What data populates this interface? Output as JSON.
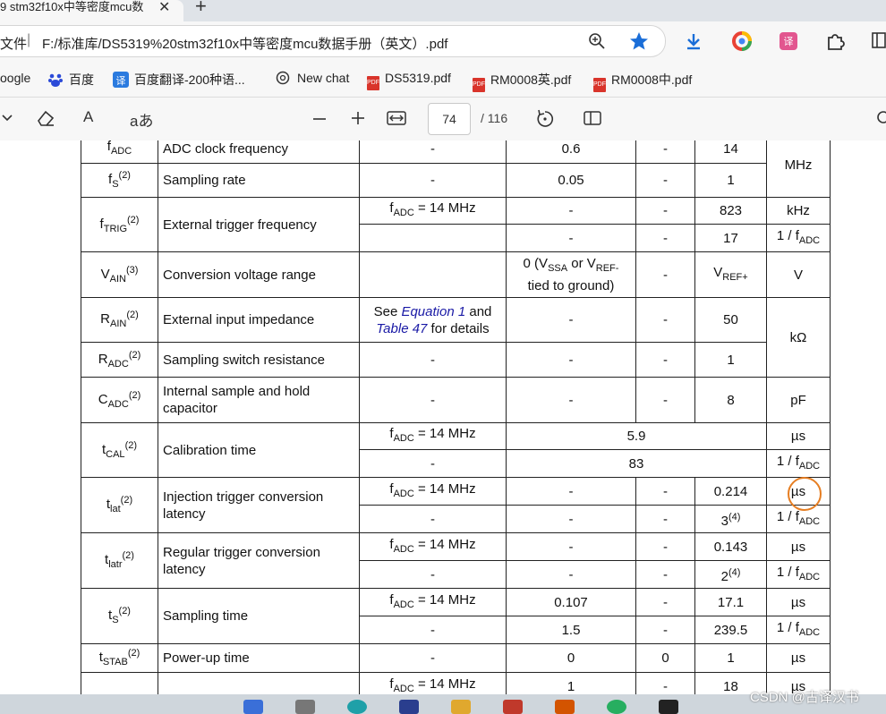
{
  "browser": {
    "tab_title": "9 stm32f10x中等密度mcu数",
    "tab_close": "✕",
    "new_tab": "+",
    "address_prefix": "文件",
    "address_sep": "|",
    "address_url": "F:/标准库/DS5319%20stm32f10x中等密度mcu数据手册（英文）.pdf",
    "bookmarks": [
      {
        "label": "oogle",
        "icon": "google-icon"
      },
      {
        "label": "百度",
        "icon": "baidu-icon"
      },
      {
        "label": "百度翻译-200种语...",
        "icon": "translate-icon"
      },
      {
        "label": "New chat",
        "icon": "chatgpt-icon"
      },
      {
        "label": "DS5319.pdf",
        "icon": "pdf-icon"
      },
      {
        "label": "RM0008英.pdf",
        "icon": "pdf-icon"
      },
      {
        "label": "RM0008中.pdf",
        "icon": "pdf-icon"
      }
    ],
    "pdf_icon_text": "PDF"
  },
  "pdf_toolbar": {
    "current_page": "74",
    "total_pages": "/ 116",
    "read_aloud_label": "A",
    "text_label": "aあ"
  },
  "table": {
    "rows": [
      {
        "sym": "f",
        "sub": "ADC",
        "sup": "",
        "param": "ADC clock frequency",
        "cond": "-",
        "min": "0.6",
        "typ": "-",
        "max": "14",
        "unit": "MHz"
      },
      {
        "sym": "f",
        "sub": "S",
        "sup": "(2)",
        "param": "Sampling rate",
        "cond": "-",
        "min": "0.05",
        "typ": "-",
        "max": "1"
      },
      {
        "sym": "f",
        "sub": "TRIG",
        "sup": "(2)",
        "param": "External trigger frequency",
        "cond_a": "= 14 MHz",
        "min_a": "-",
        "typ_a": "-",
        "max_a": "823",
        "unit_a": "kHz",
        "cond_b": "",
        "min_b": "-",
        "typ_b": "-",
        "max_b": "17",
        "unit_b": "1 / f"
      },
      {
        "sym": "V",
        "sub": "AIN",
        "sup": "(3)",
        "param": "Conversion voltage range",
        "cond": "",
        "min_l1": "0 (V",
        "min_l1b": " or V",
        "min_l1c": "REF-",
        "min_l2": "tied to ground)",
        "typ": "-",
        "max": "V",
        "max_sub": "REF+",
        "unit": "V"
      },
      {
        "sym": "R",
        "sub": "AIN",
        "sup": "(2)",
        "param": "External input impedance",
        "cond_see": "See ",
        "cond_link1": "Equation 1",
        "cond_and": " and",
        "cond_link2": "Table 47",
        "cond_tail": " for details",
        "min": "-",
        "typ": "-",
        "max": "50",
        "unit": "kΩ"
      },
      {
        "sym": "R",
        "sub": "ADC",
        "sup": "(2)",
        "param": "Sampling switch resistance",
        "cond": "-",
        "min": "-",
        "typ": "-",
        "max": "1"
      },
      {
        "sym": "C",
        "sub": "ADC",
        "sup": "(2)",
        "param_l1": "Internal sample and hold",
        "param_l2": "capacitor",
        "cond": "-",
        "min": "-",
        "typ": "-",
        "max": "8",
        "unit": "pF"
      },
      {
        "sym": "t",
        "sub": "CAL",
        "sup": "(2)",
        "param": "Calibration time",
        "cond_a": "= 14 MHz",
        "val_a": "5.9",
        "unit_a": "µs",
        "cond_b": "-",
        "val_b": "83",
        "unit_b": "1 / f"
      },
      {
        "sym": "t",
        "sub": "lat",
        "sup": "(2)",
        "param_l1": "Injection trigger conversion",
        "param_l2": "latency",
        "cond_a": "= 14 MHz",
        "min_a": "-",
        "typ_a": "-",
        "max_a": "0.214",
        "unit_a": "µs",
        "cond_b": "-",
        "min_b": "-",
        "typ_b": "-",
        "max_b": "3",
        "max_b_sup": "(4)",
        "unit_b": "1 / f"
      },
      {
        "sym": "t",
        "sub": "latr",
        "sup": "(2)",
        "param_l1": "Regular trigger conversion",
        "param_l2": "latency",
        "cond_a": "= 14 MHz",
        "min_a": "-",
        "typ_a": "-",
        "max_a": "0.143",
        "unit_a": "µs",
        "cond_b": "-",
        "min_b": "-",
        "typ_b": "-",
        "max_b": "2",
        "max_b_sup": "(4)",
        "unit_b": "1 / f"
      },
      {
        "sym": "t",
        "sub": "S",
        "sup": "(2)",
        "param": "Sampling time",
        "cond_a": "= 14 MHz",
        "min_a": "0.107",
        "typ_a": "-",
        "max_a": "17.1",
        "unit_a": "µs",
        "cond_b": "-",
        "min_b": "1.5",
        "typ_b": "-",
        "max_b": "239.5",
        "unit_b": "1 / f"
      },
      {
        "sym": "t",
        "sub": "STAB",
        "sup": "(2)",
        "param": "Power-up time",
        "cond": "-",
        "min": "0",
        "typ": "0",
        "max": "1",
        "unit": "µs"
      },
      {
        "cond": "= 14 MHz",
        "min": "1",
        "typ": "-",
        "max": "18",
        "unit": "µs"
      }
    ],
    "fadc_sym": "f",
    "fadc_sub": "ADC",
    "vssa_sub": "SSA"
  },
  "watermark": "CSDN @古译汉书"
}
